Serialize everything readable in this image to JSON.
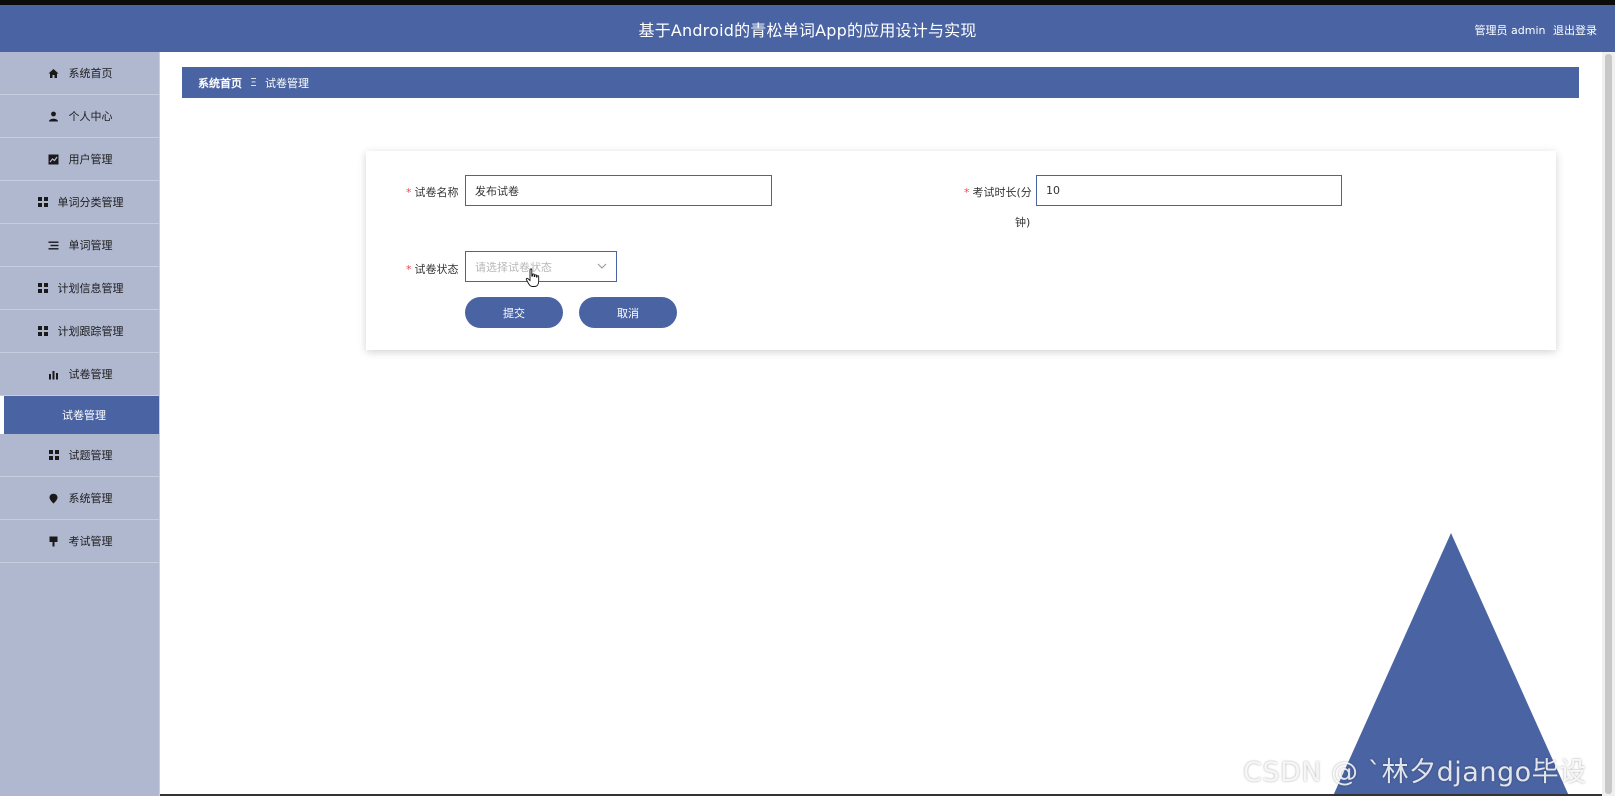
{
  "header": {
    "title": "基于Android的青松单词App的应用设计与实现",
    "user_label": "管理员 admin",
    "logout_label": "退出登录"
  },
  "sidebar": {
    "items": [
      {
        "label": "系统首页",
        "icon": "home-icon"
      },
      {
        "label": "个人中心",
        "icon": "user-icon"
      },
      {
        "label": "用户管理",
        "icon": "chart-area-icon"
      },
      {
        "label": "单词分类管理",
        "icon": "grid-icon"
      },
      {
        "label": "单词管理",
        "icon": "list-icon"
      },
      {
        "label": "计划信息管理",
        "icon": "grid-icon"
      },
      {
        "label": "计划跟踪管理",
        "icon": "grid-icon"
      },
      {
        "label": "试卷管理",
        "icon": "bar-chart-icon"
      },
      {
        "label": "试题管理",
        "icon": "grid-icon"
      },
      {
        "label": "系统管理",
        "icon": "pin-icon"
      },
      {
        "label": "考试管理",
        "icon": "pushpin-icon"
      }
    ],
    "subitem": {
      "label": "试卷管理"
    }
  },
  "breadcrumb": {
    "home": "系统首页",
    "separator": "Ξ",
    "current": "试卷管理"
  },
  "form": {
    "required_mark": "*",
    "name_label": "试卷名称",
    "name_value": "发布试卷",
    "duration_label_line1": "考试时长(分",
    "duration_label_line2": "钟)",
    "duration_value": "10",
    "status_label": "试卷状态",
    "status_placeholder": "请选择试卷状态",
    "submit_label": "提交",
    "cancel_label": "取消"
  },
  "watermark": "CSDN @ ˋ林夕django毕设",
  "colors": {
    "accent": "#4a64a3",
    "sidebar_bg": "#b0b8d0",
    "required": "#e04a4a"
  }
}
